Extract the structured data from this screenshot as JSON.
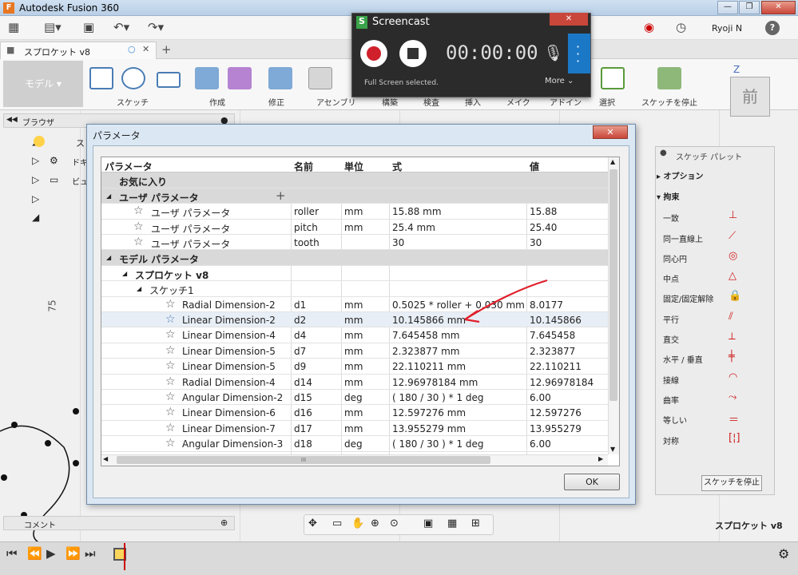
{
  "app": {
    "title": "Autodesk Fusion 360",
    "user": "Ryoji N",
    "help": "?"
  },
  "doc": {
    "tab": "スプロケット v8",
    "new_tab": "+",
    "canvas_label": "スプロケット v8"
  },
  "ribbon": {
    "model": "モデル",
    "groups": [
      "スケッチ",
      "作成",
      "修正",
      "アセンブリ",
      "構築",
      "検査",
      "挿入",
      "メイク",
      "アドイン",
      "選択",
      "スケッチを停止"
    ]
  },
  "browser": {
    "title": "ブラウザ",
    "items": [
      "ス",
      "ドキ",
      "ビュ"
    ]
  },
  "comment": {
    "title": "コメント"
  },
  "view_cube": {
    "face": "前",
    "axis": "Z"
  },
  "axis_label": "75",
  "screencast": {
    "title": "Screencast",
    "time": "00:00:00",
    "status": "Full Screen selected.",
    "more": "More"
  },
  "dialog": {
    "title": "パラメータ",
    "close": "✕",
    "ok": "OK",
    "columns": [
      "パラメータ",
      "名前",
      "単位",
      "式",
      "値"
    ],
    "favorites": "お気に入り",
    "user_params": "ユーザ パラメータ",
    "user_rows": [
      {
        "label": "ユーザ パラメータ",
        "name": "roller",
        "unit": "mm",
        "expr": "15.88 mm",
        "value": "15.88"
      },
      {
        "label": "ユーザ パラメータ",
        "name": "pitch",
        "unit": "mm",
        "expr": "25.4 mm",
        "value": "25.40"
      },
      {
        "label": "ユーザ パラメータ",
        "name": "tooth",
        "unit": "",
        "expr": "30",
        "value": "30"
      }
    ],
    "model_params": "モデル パラメータ",
    "component": "スプロケット v8",
    "sketch": "スケッチ1",
    "model_rows": [
      {
        "label": "Radial Dimension-2",
        "name": "d1",
        "unit": "mm",
        "expr": "0.5025 * roller + 0.030 mm",
        "value": "8.0177"
      },
      {
        "label": "Linear Dimension-2",
        "name": "d2",
        "unit": "mm",
        "expr": "10.145866 mm",
        "value": "10.145866"
      },
      {
        "label": "Linear Dimension-4",
        "name": "d4",
        "unit": "mm",
        "expr": "7.645458 mm",
        "value": "7.645458"
      },
      {
        "label": "Linear Dimension-5",
        "name": "d7",
        "unit": "mm",
        "expr": "2.323877 mm",
        "value": "2.323877"
      },
      {
        "label": "Linear Dimension-5",
        "name": "d9",
        "unit": "mm",
        "expr": "22.110211 mm",
        "value": "22.110211"
      },
      {
        "label": "Radial Dimension-4",
        "name": "d14",
        "unit": "mm",
        "expr": "12.96978184 mm",
        "value": "12.96978184"
      },
      {
        "label": "Angular Dimension-2",
        "name": "d15",
        "unit": "deg",
        "expr": "( 180 / 30 ) * 1 deg",
        "value": "6.00"
      },
      {
        "label": "Linear Dimension-6",
        "name": "d16",
        "unit": "mm",
        "expr": "12.597276 mm",
        "value": "12.597276"
      },
      {
        "label": "Linear Dimension-7",
        "name": "d17",
        "unit": "mm",
        "expr": "13.955279 mm",
        "value": "13.955279"
      },
      {
        "label": "Angular Dimension-3",
        "name": "d18",
        "unit": "deg",
        "expr": "( 180 / 30 ) * 1 deg",
        "value": "6.00"
      }
    ],
    "scroll_grip": "III"
  },
  "palette": {
    "title": "スケッチ パレット",
    "options": "オプション",
    "constraints": "拘束",
    "items": [
      "一致",
      "同一直線上",
      "同心円",
      "中点",
      "固定/固定解除",
      "平行",
      "直交",
      "水平 / 垂直",
      "接線",
      "曲率",
      "等しい",
      "対称"
    ],
    "stop": "スケッチを停止"
  },
  "colors": {
    "accent": "#1b78c7",
    "record": "#d0202c",
    "annotation": "#e0202c"
  }
}
